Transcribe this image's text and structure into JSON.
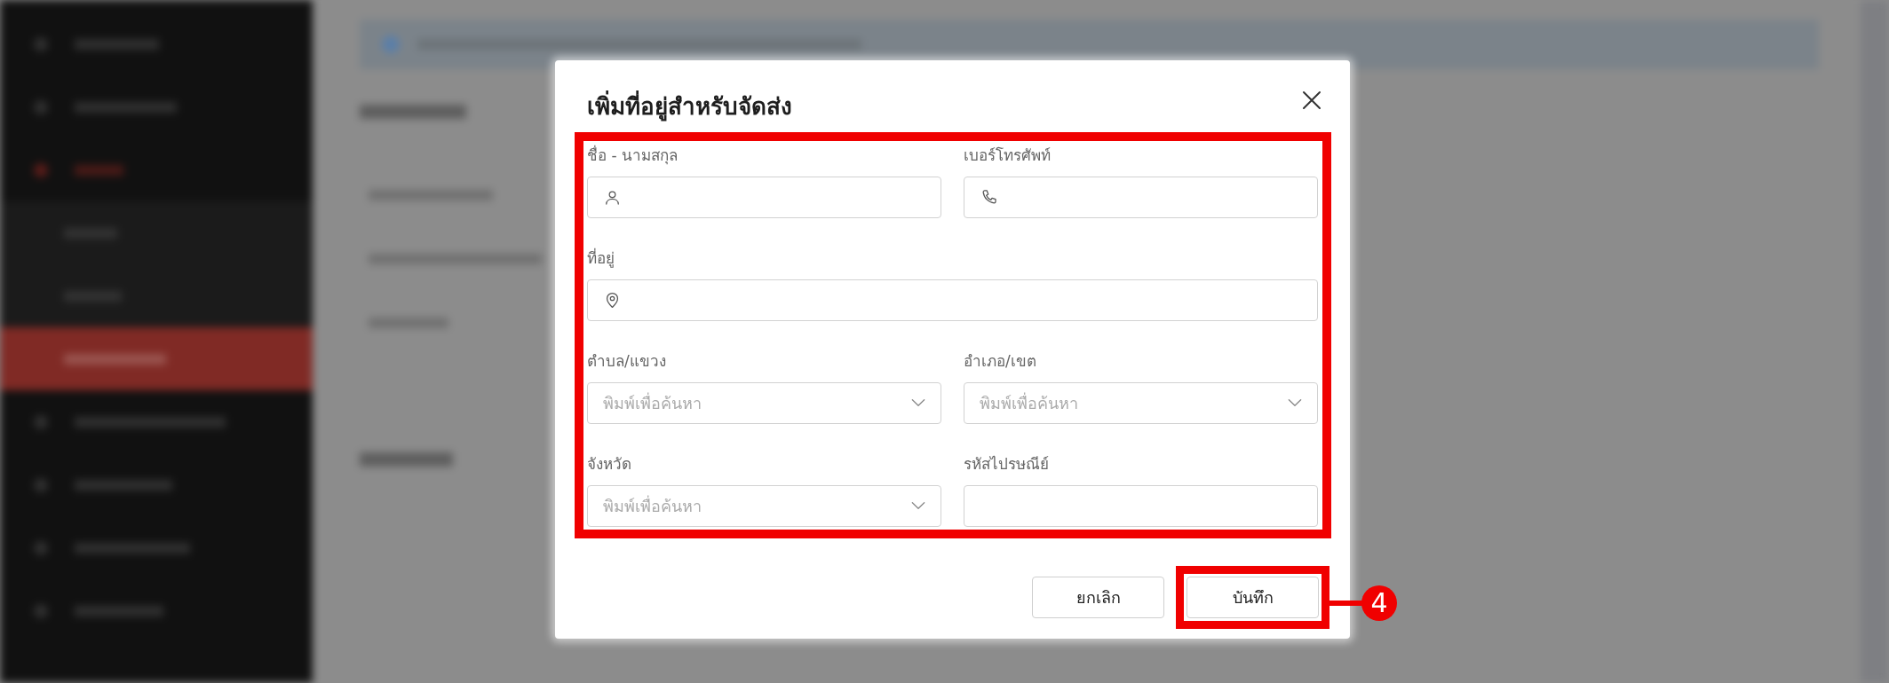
{
  "dialog": {
    "title": "เพิ่มที่อยู่สำหรับจัดส่ง"
  },
  "form": {
    "highlighted": true,
    "fields": [
      {
        "label": "ชื่อ - นามสกุล",
        "kind": "name"
      },
      {
        "label": "เบอร์โทรศัพท์",
        "kind": "phone"
      },
      {
        "label": "ที่อยู่",
        "kind": "address"
      },
      {
        "label": "ตำบล/แขวง",
        "kind": "select",
        "placeholder": "พิมพ์เพื่อค้นหา"
      },
      {
        "label": "อำเภอ/เขต",
        "kind": "select",
        "placeholder": "พิมพ์เพื่อค้นหา"
      },
      {
        "label": "จังหวัด",
        "kind": "select",
        "placeholder": "พิมพ์เพื่อค้นหา"
      },
      {
        "label": "รหัสไปรษณีย์",
        "kind": "text"
      }
    ]
  },
  "buttons": [
    {
      "label": "ยกเลิก",
      "highlighted": false
    },
    {
      "label": "บันทึก",
      "highlighted": true,
      "callout": "4"
    }
  ]
}
